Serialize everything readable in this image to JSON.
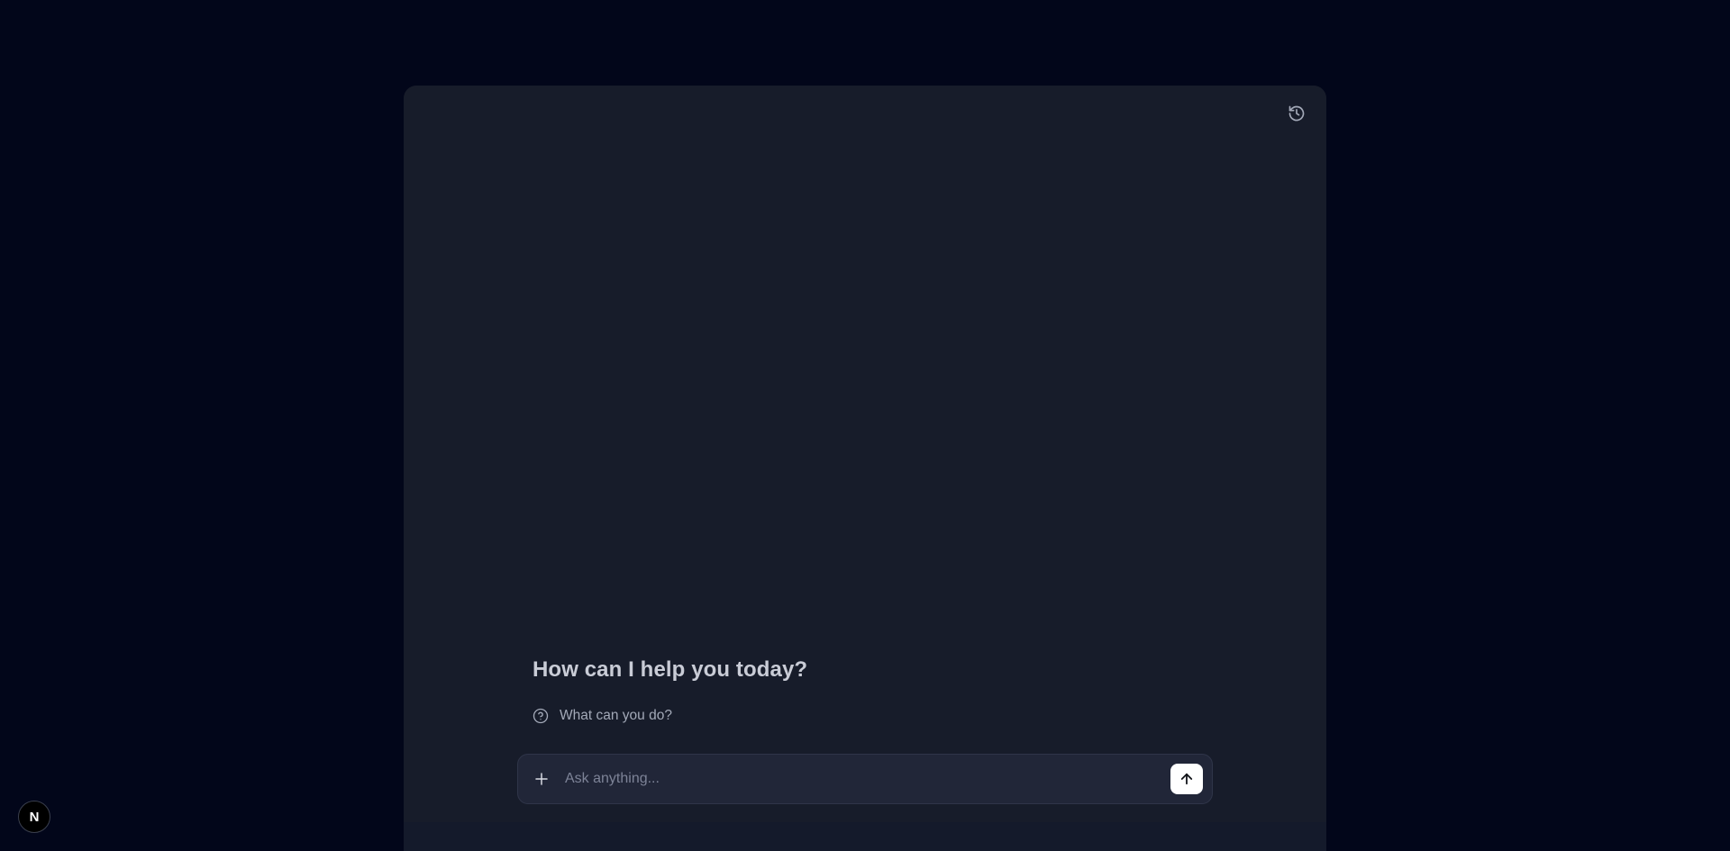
{
  "chat": {
    "welcome_title": "How can I help you today?",
    "suggestions": [
      {
        "label": "What can you do?",
        "icon": "question-circle-icon"
      }
    ],
    "input": {
      "placeholder": "Ask anything...",
      "value": ""
    },
    "icons": {
      "history": "history-icon",
      "attach": "plus-icon",
      "send": "arrow-up-icon"
    }
  },
  "dev_badge": {
    "letter": "N"
  },
  "colors": {
    "page_background": "#02061a",
    "panel_background": "#171c2a",
    "input_background": "#212638",
    "send_button": "#ffffff"
  }
}
